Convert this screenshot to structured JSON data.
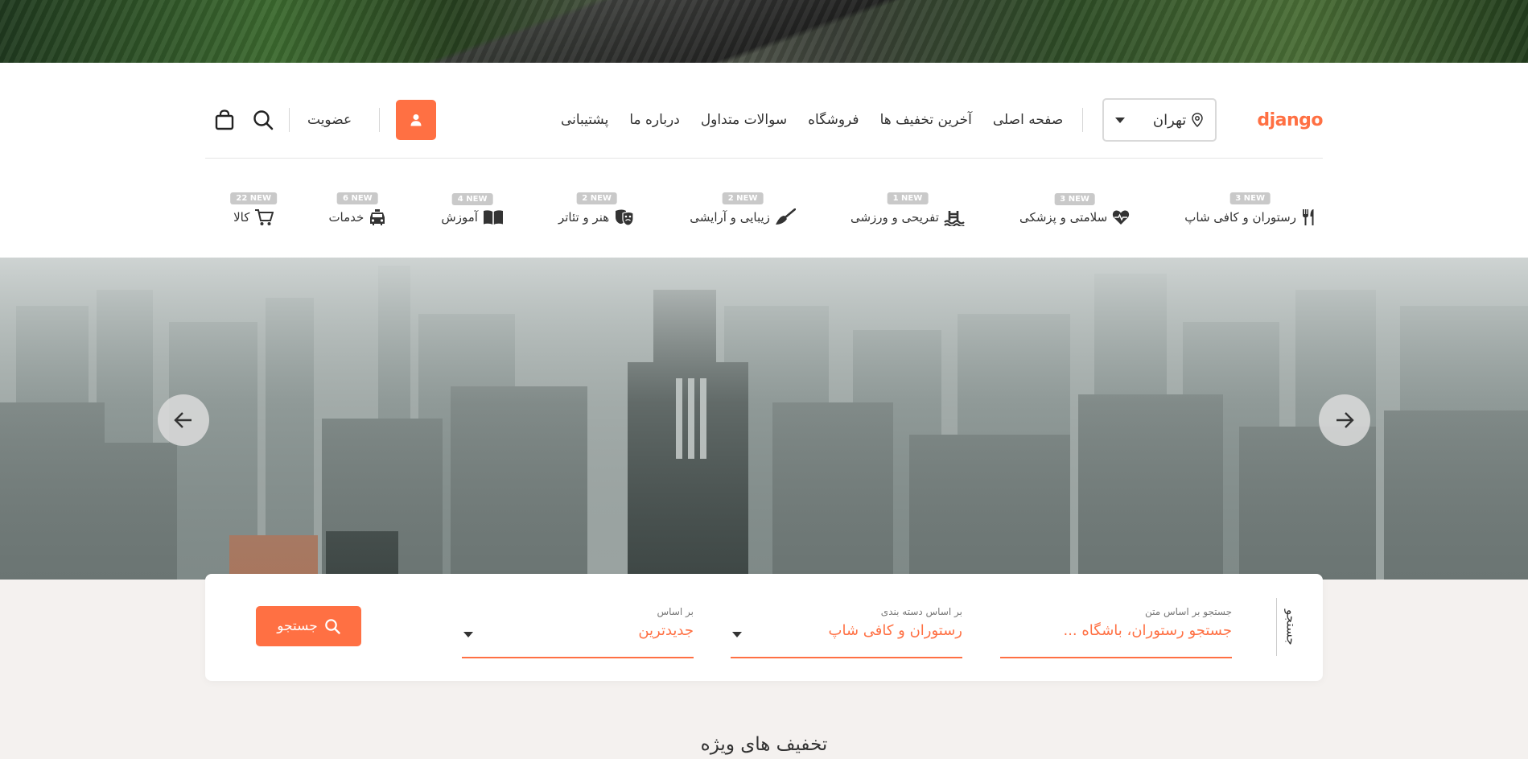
{
  "brand": {
    "logo": "django",
    "accent": "#ff7043"
  },
  "header": {
    "city": "تهران",
    "nav": [
      "صفحه اصلی",
      "آخرین تخفیف ها",
      "فروشگاه",
      "سوالات متداول",
      "درباره ما",
      "پشتیبانی"
    ],
    "member_label": "عضویت"
  },
  "categories": [
    {
      "label": "رستوران و کافی شاپ",
      "badge": "3 NEW",
      "icon": "utensils-icon"
    },
    {
      "label": "سلامتی و پزشکی",
      "badge": "3 NEW",
      "icon": "heartbeat-icon"
    },
    {
      "label": "تفریحی و ورزشی",
      "badge": "1 NEW",
      "icon": "swimming-icon"
    },
    {
      "label": "زیبایی و آرایشی",
      "badge": "2 NEW",
      "icon": "broom-icon"
    },
    {
      "label": "هنر و تئاتر",
      "badge": "2 NEW",
      "icon": "theater-masks-icon"
    },
    {
      "label": "آموزش",
      "badge": "4 NEW",
      "icon": "book-icon"
    },
    {
      "label": "خدمات",
      "badge": "6 NEW",
      "icon": "taxi-icon"
    },
    {
      "label": "کالا",
      "badge": "22 NEW",
      "icon": "cart-icon"
    }
  ],
  "search": {
    "title": "جستجو",
    "text_field": {
      "label": "جستجو بر اساس متن",
      "placeholder": "جستجو رستوران، باشگاه ..."
    },
    "category_field": {
      "label": "بر اساس دسته بندی",
      "value": "رستوران و کافی شاپ"
    },
    "sort_field": {
      "label": "بر اساس",
      "value": "جدیدترین"
    },
    "button_label": "جستجو"
  },
  "sections": {
    "special_offers_title": "تخفیف های ویژه"
  }
}
